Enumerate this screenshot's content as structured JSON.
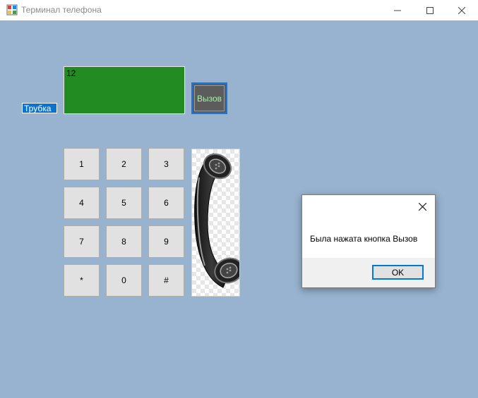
{
  "window": {
    "title": "Терминал телефона",
    "icon": "winforms-app-icon",
    "controls": [
      "minimize-icon",
      "maximize-icon",
      "close-icon"
    ]
  },
  "form": {
    "background": "#97b3cf",
    "tube_label": "Трубка",
    "display_text": "12",
    "display_color": "#228b22",
    "call_button_label": "Вызов",
    "keypad": [
      "1",
      "2",
      "3",
      "4",
      "5",
      "6",
      "7",
      "8",
      "9",
      "*",
      "0",
      "#"
    ],
    "phone_image": "telephone-handset-icon"
  },
  "dialog": {
    "message": "Была нажата кнопка Вызов",
    "ok_label": "OK"
  }
}
